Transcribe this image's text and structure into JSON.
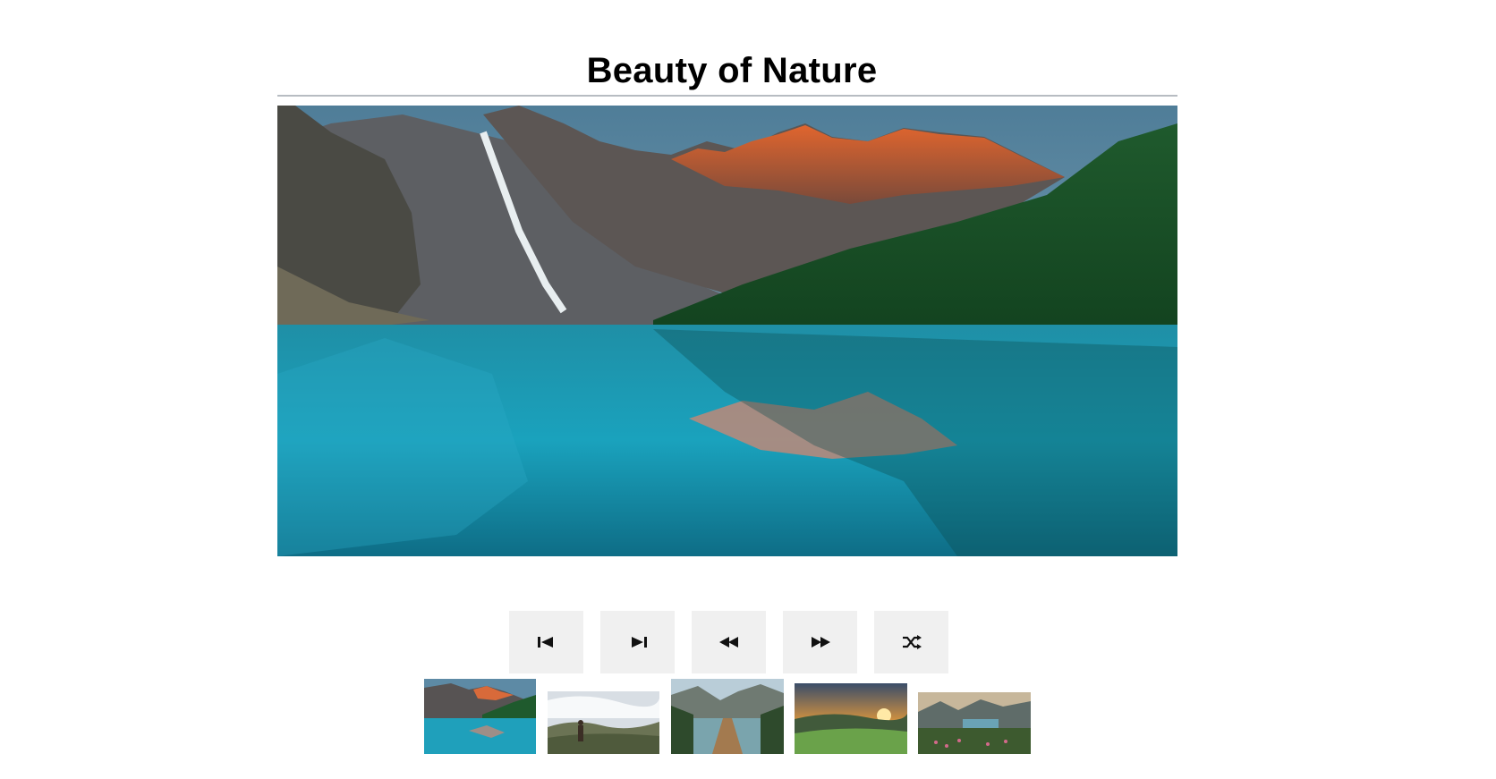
{
  "page": {
    "title": "Beauty of Nature"
  },
  "hero": {
    "image": "mountain-lake-photo"
  },
  "controls": [
    {
      "name": "first-button",
      "icon": "skip-first-icon"
    },
    {
      "name": "last-button",
      "icon": "skip-last-icon"
    },
    {
      "name": "previous-button",
      "icon": "rewind-icon"
    },
    {
      "name": "next-button",
      "icon": "fast-forward-icon"
    },
    {
      "name": "shuffle-button",
      "icon": "shuffle-icon"
    }
  ],
  "thumbnails": [
    {
      "image": "mountain-lake-thumbnail",
      "selected": true
    },
    {
      "image": "hiker-sky-thumbnail",
      "selected": false
    },
    {
      "image": "boardwalk-lake-thumbnail",
      "selected": false
    },
    {
      "image": "sunset-meadow-thumbnail",
      "selected": false
    },
    {
      "image": "alpine-flowers-thumbnail",
      "selected": false
    }
  ],
  "colors": {
    "button_bg": "#f0f0f0",
    "divider": "#b7bcc2",
    "title": "#000000"
  }
}
